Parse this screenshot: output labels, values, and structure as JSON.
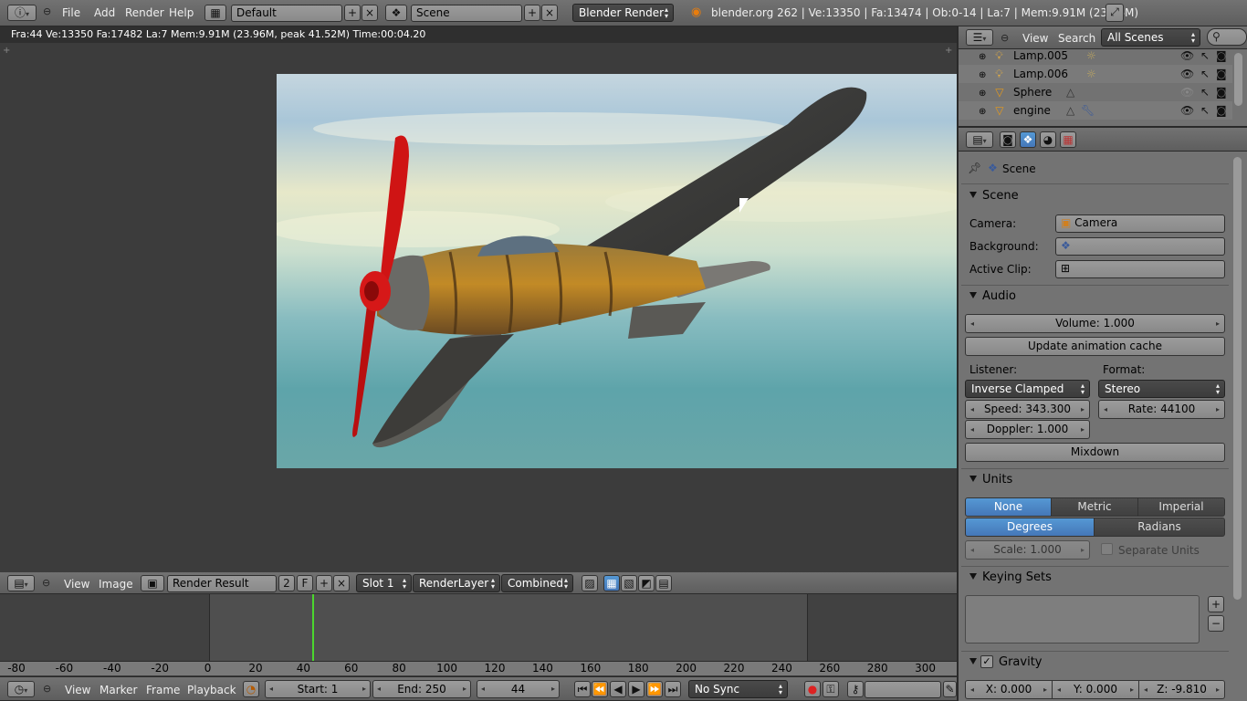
{
  "top_header": {
    "menus": [
      "File",
      "Add",
      "Render",
      "Help"
    ],
    "layout": "Default",
    "scene": "Scene",
    "engine": "Blender Render",
    "stats": "blender.org 262 | Ve:13350 | Fa:13474 | Ob:0-14 | La:7 | Mem:9.91M (23.96M)"
  },
  "image_editor": {
    "render_stats": "Fra:44  Ve:13350 Fa:17482 La:7 Mem:9.91M (23.96M, peak 41.52M) Time:00:04.20",
    "header": {
      "view": "View",
      "image": "Image",
      "image_name": "Render Result",
      "users": "2",
      "fake": "F",
      "slot": "Slot 1",
      "layer": "RenderLayer",
      "pass": "Combined"
    }
  },
  "outliner": {
    "view": "View",
    "search": "Search",
    "filter": "All Scenes",
    "rows": [
      {
        "name": "Lamp.005",
        "type": "lamp"
      },
      {
        "name": "Lamp.006",
        "type": "lamp"
      },
      {
        "name": "Sphere",
        "type": "mesh"
      },
      {
        "name": "engine",
        "type": "mesh"
      }
    ]
  },
  "properties": {
    "context": "Scene",
    "scene_panel": {
      "title": "Scene",
      "camera_label": "Camera:",
      "camera_value": "Camera",
      "background_label": "Background:",
      "active_clip_label": "Active Clip:"
    },
    "audio_panel": {
      "title": "Audio",
      "volume": "Volume: 1.000",
      "update_cache": "Update animation cache",
      "listener_label": "Listener:",
      "format_label": "Format:",
      "listener": "Inverse Clamped",
      "format": "Stereo",
      "speed": "Speed: 343.300",
      "rate": "Rate: 44100",
      "doppler": "Doppler: 1.000",
      "mixdown": "Mixdown"
    },
    "units_panel": {
      "title": "Units",
      "systems": [
        "None",
        "Metric",
        "Imperial"
      ],
      "rotation": [
        "Degrees",
        "Radians"
      ],
      "scale": "Scale: 1.000",
      "separate": "Separate Units"
    },
    "keying_panel": {
      "title": "Keying Sets"
    },
    "gravity_panel": {
      "title": "Gravity",
      "x": "X: 0.000",
      "y": "Y: 0.000",
      "z": "Z: -9.810"
    }
  },
  "timeline": {
    "ticks": [
      "-80",
      "-60",
      "-40",
      "-20",
      "0",
      "20",
      "40",
      "60",
      "80",
      "100",
      "120",
      "140",
      "160",
      "180",
      "200",
      "220",
      "240",
      "260",
      "280",
      "300"
    ],
    "current_frame": 44,
    "header": {
      "view": "View",
      "marker": "Marker",
      "frame": "Frame",
      "playback": "Playback",
      "start": "Start: 1",
      "end": "End: 250",
      "current": "44",
      "sync": "No Sync"
    }
  },
  "colors": {
    "accent": "#5a8fd0",
    "frame_line": "#4bd62e",
    "panel_bg": "#737373"
  }
}
